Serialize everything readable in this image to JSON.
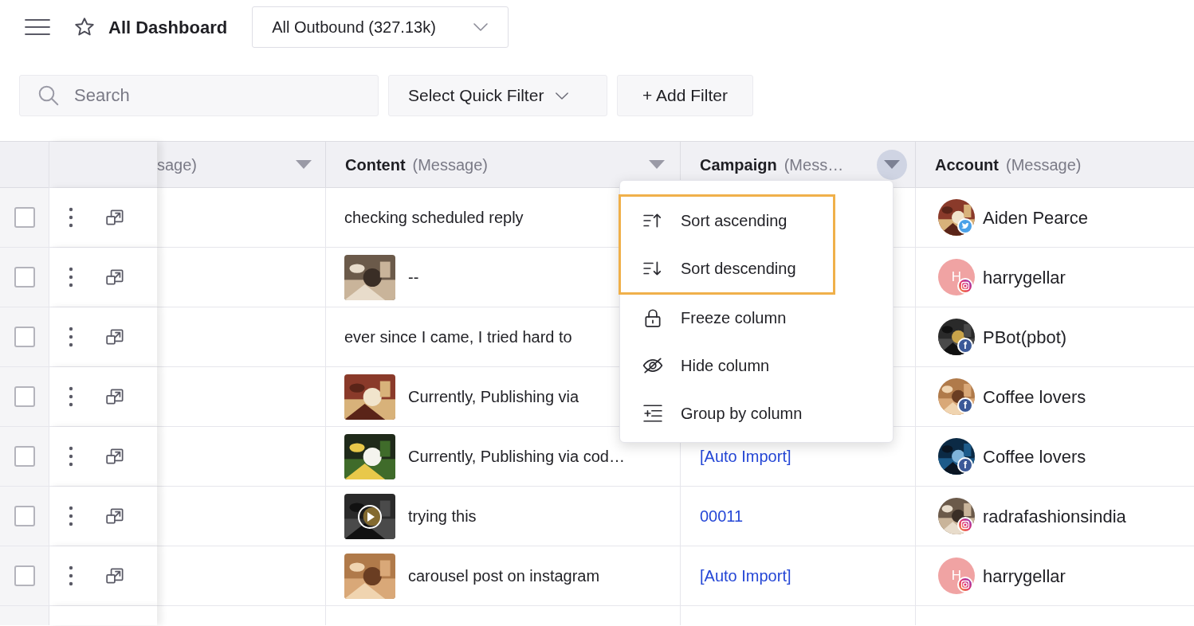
{
  "header": {
    "title": "All Dashboard",
    "view_select": "All Outbound (327.13k)"
  },
  "filters": {
    "search_placeholder": "Search",
    "quick_filter": "Select Quick Filter",
    "add_filter": "+ Add Filter"
  },
  "columns": [
    {
      "qualifier": "sage)",
      "menu_open": false
    },
    {
      "name": "Content",
      "qualifier": "(Message)",
      "menu_open": false
    },
    {
      "name": "Campaign",
      "qualifier": "(Mess…",
      "menu_open": true
    },
    {
      "name": "Account",
      "qualifier": "(Message)"
    }
  ],
  "rows": [
    {
      "checked": false,
      "content": {
        "kind": "text",
        "text": "checking scheduled reply"
      },
      "account": {
        "name": "Aiden Pearce",
        "badge": {
          "kind": "twitter"
        }
      }
    },
    {
      "checked": false,
      "content": {
        "text": "--"
      },
      "account": {
        "name": "harrygellar",
        "kind": "initial",
        "initial": "H",
        "badge": {
          "kind": "instagram"
        }
      }
    },
    {
      "checked": false,
      "content": {
        "kind": "text",
        "text": "ever since I came, I tried hard to"
      },
      "account": {
        "name": "PBot(pbot)",
        "badge": {
          "kind": "facebook",
          "letter": "f"
        }
      }
    },
    {
      "checked": false,
      "content": {
        "text": "Currently, Publishing via"
      },
      "account": {
        "name": "Coffee lovers",
        "badge": {
          "kind": "facebook",
          "letter": "f"
        }
      }
    },
    {
      "checked": false,
      "content": {
        "text": "Currently, Publishing via cod…"
      },
      "campaign": "[Auto Import]",
      "account": {
        "name": "Coffee lovers",
        "badge": {
          "kind": "facebook",
          "letter": "f"
        }
      }
    },
    {
      "checked": false,
      "content": {
        "kind": "video",
        "text": "trying this"
      },
      "campaign": "00011",
      "account": {
        "name": "radrafashionsindia",
        "badge": {
          "kind": "instagram"
        }
      }
    },
    {
      "checked": false,
      "content": {
        "text": "carousel post on instagram"
      },
      "campaign": "[Auto Import]",
      "account": {
        "name": "harrygellar",
        "kind": "initial",
        "initial": "H",
        "badge": {
          "kind": "instagram"
        }
      }
    }
  ],
  "column_menu": [
    {
      "label": "Sort ascending",
      "kind": "sort-up",
      "highlighted": true
    },
    {
      "label": "Sort descending",
      "kind": "sort-down",
      "highlighted": true
    },
    {
      "label": "Freeze column",
      "kind": "lock",
      "highlighted": false
    },
    {
      "label": "Hide column",
      "kind": "hide",
      "highlighted": false
    },
    {
      "label": "Group by column",
      "kind": "group",
      "highlighted": false
    }
  ]
}
